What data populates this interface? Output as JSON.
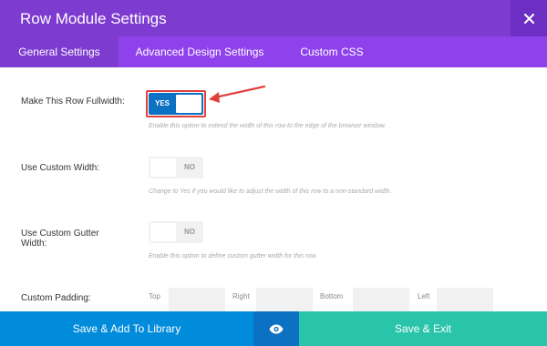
{
  "header": {
    "title": "Row Module Settings",
    "close_icon": "close-icon",
    "background": "#7e3bd0"
  },
  "tabs": [
    {
      "label": "General Settings",
      "active": true
    },
    {
      "label": "Advanced Design Settings",
      "active": false
    },
    {
      "label": "Custom CSS",
      "active": false
    }
  ],
  "settings": {
    "fullwidth": {
      "label": "Make This Row Fullwidth:",
      "toggle_text": "YES",
      "state": "on",
      "description": "Enable this option to extend the width of this row to the edge of the browser window."
    },
    "custom_width": {
      "label": "Use Custom Width:",
      "toggle_text": "NO",
      "state": "off",
      "description": "Change to Yes if you would like to adjust the width of this row to a non-standard width."
    },
    "custom_gutter": {
      "label_line1": "Use Custom Gutter",
      "label_line2": "Width:",
      "toggle_text": "NO",
      "state": "off",
      "description": "Enable this option to define custom gutter width for this row."
    },
    "custom_padding": {
      "label": "Custom Padding:",
      "fields": [
        {
          "label": "Top",
          "value": ""
        },
        {
          "label": "Right",
          "value": ""
        },
        {
          "label": "Bottom",
          "value": ""
        },
        {
          "label": "Left",
          "value": ""
        }
      ]
    }
  },
  "footer": {
    "library_label": "Save & Add To Library",
    "preview_icon": "eye-icon",
    "save_label": "Save & Exit",
    "colors": {
      "library": "#008bdb",
      "preview": "#0c71c3",
      "save": "#29c4a9"
    }
  },
  "annotation": {
    "color": "#e0413b",
    "arrow_icon": "red-arrow-icon"
  }
}
